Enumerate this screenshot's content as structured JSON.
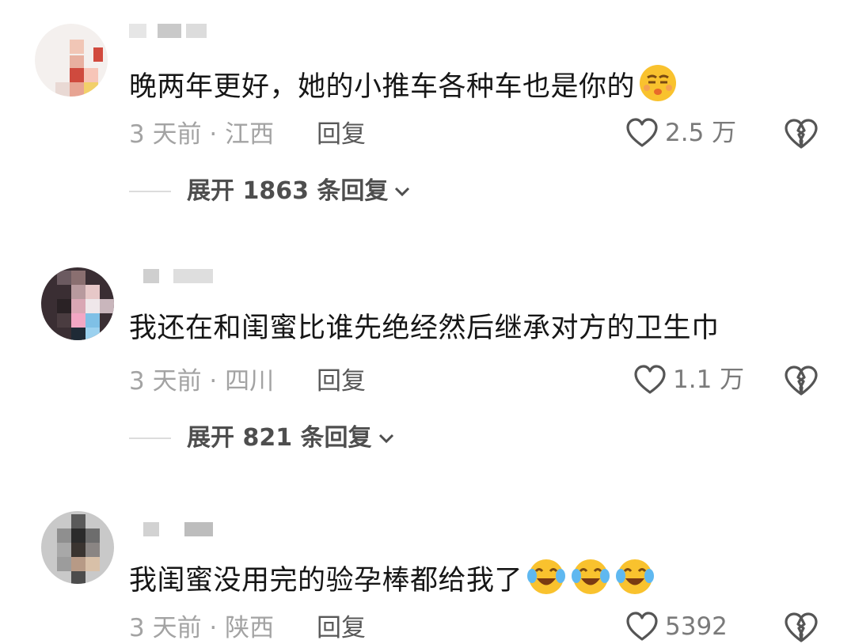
{
  "comments": [
    {
      "text": "晚两年更好，她的小推车各种车也是你的",
      "emojis": [
        "smirk-emoji"
      ],
      "time_location": "3 天前 · 江西",
      "reply_label": "回复",
      "likes": "2.5 万",
      "expand_label": "展开 1863 条回复"
    },
    {
      "text": "我还在和闺蜜比谁先绝经然后继承对方的卫生巾",
      "emojis": [],
      "time_location": "3 天前 · 四川",
      "reply_label": "回复",
      "likes": "1.1 万",
      "expand_label": "展开 821 条回复"
    },
    {
      "text": "我闺蜜没用完的验孕棒都给我了",
      "emojis": [
        "crying-laughing-emoji",
        "crying-laughing-emoji",
        "crying-laughing-emoji"
      ],
      "time_location": "3 天前 · 陕西",
      "reply_label": "回复",
      "likes": "5392"
    }
  ],
  "colors": {
    "meta_text": "#a3a3a3",
    "reply_text": "#585858",
    "expand_text": "#4e4e4e",
    "emoji_face": "#f9c22e"
  }
}
